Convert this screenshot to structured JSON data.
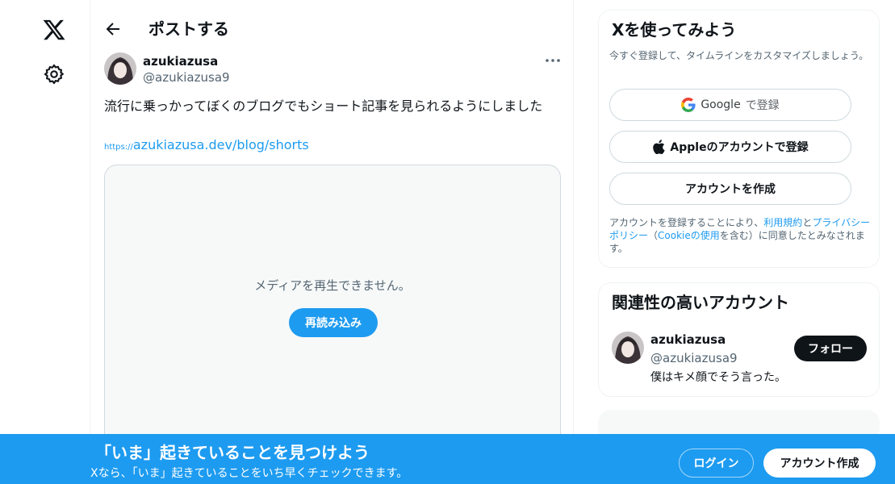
{
  "nav": {
    "logo_icon": "x-logo-icon",
    "settings_icon": "gear-icon"
  },
  "header": {
    "title": "ポストする"
  },
  "post": {
    "author_name": "azukiazusa",
    "author_handle": "@azukiazusa9",
    "text": "流行に乗っかってぼくのブログでもショート記事を見られるようにしました",
    "link_protocol": "https://",
    "link_text": "azukiazusa.dev/blog/shorts",
    "media_message": "メディアを再生できません。",
    "reload_label": "再読み込み"
  },
  "signup_card": {
    "title": "Xを使ってみよう",
    "subtitle": "今すぐ登録して、タイムラインをカスタマイズしましょう。",
    "google_label": "Google",
    "google_suffix": "で登録",
    "apple_label": "Appleのアカウントで登録",
    "create_label": "アカウントを作成",
    "legal_prefix": "アカウントを登録することにより、",
    "terms_link": "利用規約",
    "legal_and": "と",
    "privacy_link": "プライバシーポリシー",
    "legal_paren_open": "（",
    "cookie_link": "Cookieの使用",
    "legal_suffix": "を含む）に同意したとみなされます。"
  },
  "relevant_card": {
    "title": "関連性の高いアカウント",
    "account_name": "azukiazusa",
    "account_handle": "@azukiazusa9",
    "account_bio": "僕はキメ顔でそう言った。",
    "follow_label": "フォロー"
  },
  "banner": {
    "title": "「いま」起きていることを見つけよう",
    "subtitle": "Xなら、「いま」起きていることをいち早くチェックできます。",
    "login_label": "ログイン",
    "create_label": "アカウント作成"
  },
  "colors": {
    "accent": "#1d9bf0",
    "text": "#0f1419",
    "muted": "#536471"
  }
}
